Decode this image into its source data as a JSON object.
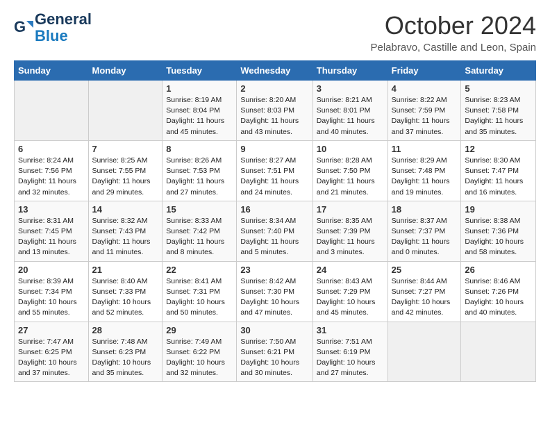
{
  "header": {
    "logo_general": "General",
    "logo_blue": "Blue",
    "month_title": "October 2024",
    "location": "Pelabravo, Castille and Leon, Spain"
  },
  "days_of_week": [
    "Sunday",
    "Monday",
    "Tuesday",
    "Wednesday",
    "Thursday",
    "Friday",
    "Saturday"
  ],
  "weeks": [
    [
      {
        "num": "",
        "detail": ""
      },
      {
        "num": "",
        "detail": ""
      },
      {
        "num": "1",
        "detail": "Sunrise: 8:19 AM\nSunset: 8:04 PM\nDaylight: 11 hours and 45 minutes."
      },
      {
        "num": "2",
        "detail": "Sunrise: 8:20 AM\nSunset: 8:03 PM\nDaylight: 11 hours and 43 minutes."
      },
      {
        "num": "3",
        "detail": "Sunrise: 8:21 AM\nSunset: 8:01 PM\nDaylight: 11 hours and 40 minutes."
      },
      {
        "num": "4",
        "detail": "Sunrise: 8:22 AM\nSunset: 7:59 PM\nDaylight: 11 hours and 37 minutes."
      },
      {
        "num": "5",
        "detail": "Sunrise: 8:23 AM\nSunset: 7:58 PM\nDaylight: 11 hours and 35 minutes."
      }
    ],
    [
      {
        "num": "6",
        "detail": "Sunrise: 8:24 AM\nSunset: 7:56 PM\nDaylight: 11 hours and 32 minutes."
      },
      {
        "num": "7",
        "detail": "Sunrise: 8:25 AM\nSunset: 7:55 PM\nDaylight: 11 hours and 29 minutes."
      },
      {
        "num": "8",
        "detail": "Sunrise: 8:26 AM\nSunset: 7:53 PM\nDaylight: 11 hours and 27 minutes."
      },
      {
        "num": "9",
        "detail": "Sunrise: 8:27 AM\nSunset: 7:51 PM\nDaylight: 11 hours and 24 minutes."
      },
      {
        "num": "10",
        "detail": "Sunrise: 8:28 AM\nSunset: 7:50 PM\nDaylight: 11 hours and 21 minutes."
      },
      {
        "num": "11",
        "detail": "Sunrise: 8:29 AM\nSunset: 7:48 PM\nDaylight: 11 hours and 19 minutes."
      },
      {
        "num": "12",
        "detail": "Sunrise: 8:30 AM\nSunset: 7:47 PM\nDaylight: 11 hours and 16 minutes."
      }
    ],
    [
      {
        "num": "13",
        "detail": "Sunrise: 8:31 AM\nSunset: 7:45 PM\nDaylight: 11 hours and 13 minutes."
      },
      {
        "num": "14",
        "detail": "Sunrise: 8:32 AM\nSunset: 7:43 PM\nDaylight: 11 hours and 11 minutes."
      },
      {
        "num": "15",
        "detail": "Sunrise: 8:33 AM\nSunset: 7:42 PM\nDaylight: 11 hours and 8 minutes."
      },
      {
        "num": "16",
        "detail": "Sunrise: 8:34 AM\nSunset: 7:40 PM\nDaylight: 11 hours and 5 minutes."
      },
      {
        "num": "17",
        "detail": "Sunrise: 8:35 AM\nSunset: 7:39 PM\nDaylight: 11 hours and 3 minutes."
      },
      {
        "num": "18",
        "detail": "Sunrise: 8:37 AM\nSunset: 7:37 PM\nDaylight: 11 hours and 0 minutes."
      },
      {
        "num": "19",
        "detail": "Sunrise: 8:38 AM\nSunset: 7:36 PM\nDaylight: 10 hours and 58 minutes."
      }
    ],
    [
      {
        "num": "20",
        "detail": "Sunrise: 8:39 AM\nSunset: 7:34 PM\nDaylight: 10 hours and 55 minutes."
      },
      {
        "num": "21",
        "detail": "Sunrise: 8:40 AM\nSunset: 7:33 PM\nDaylight: 10 hours and 52 minutes."
      },
      {
        "num": "22",
        "detail": "Sunrise: 8:41 AM\nSunset: 7:31 PM\nDaylight: 10 hours and 50 minutes."
      },
      {
        "num": "23",
        "detail": "Sunrise: 8:42 AM\nSunset: 7:30 PM\nDaylight: 10 hours and 47 minutes."
      },
      {
        "num": "24",
        "detail": "Sunrise: 8:43 AM\nSunset: 7:29 PM\nDaylight: 10 hours and 45 minutes."
      },
      {
        "num": "25",
        "detail": "Sunrise: 8:44 AM\nSunset: 7:27 PM\nDaylight: 10 hours and 42 minutes."
      },
      {
        "num": "26",
        "detail": "Sunrise: 8:46 AM\nSunset: 7:26 PM\nDaylight: 10 hours and 40 minutes."
      }
    ],
    [
      {
        "num": "27",
        "detail": "Sunrise: 7:47 AM\nSunset: 6:25 PM\nDaylight: 10 hours and 37 minutes."
      },
      {
        "num": "28",
        "detail": "Sunrise: 7:48 AM\nSunset: 6:23 PM\nDaylight: 10 hours and 35 minutes."
      },
      {
        "num": "29",
        "detail": "Sunrise: 7:49 AM\nSunset: 6:22 PM\nDaylight: 10 hours and 32 minutes."
      },
      {
        "num": "30",
        "detail": "Sunrise: 7:50 AM\nSunset: 6:21 PM\nDaylight: 10 hours and 30 minutes."
      },
      {
        "num": "31",
        "detail": "Sunrise: 7:51 AM\nSunset: 6:19 PM\nDaylight: 10 hours and 27 minutes."
      },
      {
        "num": "",
        "detail": ""
      },
      {
        "num": "",
        "detail": ""
      }
    ]
  ]
}
